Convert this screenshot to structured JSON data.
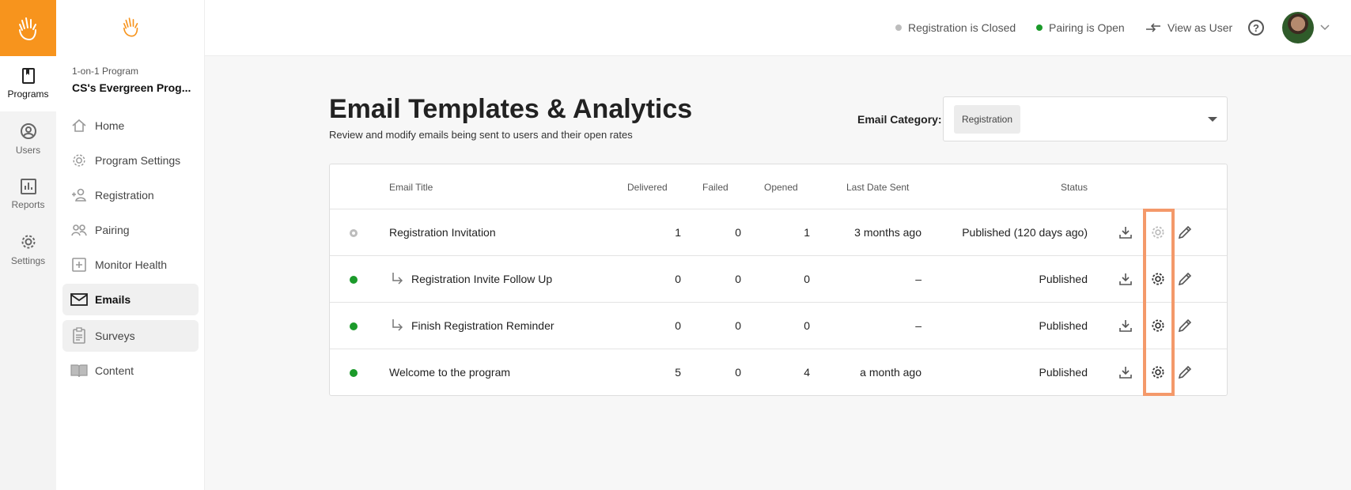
{
  "rail": {
    "items": [
      {
        "label": "Programs",
        "icon": "programs-icon"
      },
      {
        "label": "Users",
        "icon": "user-icon"
      },
      {
        "label": "Reports",
        "icon": "reports-icon"
      },
      {
        "label": "Settings",
        "icon": "gear-icon"
      }
    ]
  },
  "sidenav": {
    "program_type": "1-on-1 Program",
    "program_name": "CS's Evergreen Prog...",
    "items": [
      {
        "label": "Home",
        "icon": "home-icon"
      },
      {
        "label": "Program Settings",
        "icon": "gear-icon"
      },
      {
        "label": "Registration",
        "icon": "add-user-icon"
      },
      {
        "label": "Pairing",
        "icon": "pairing-icon"
      },
      {
        "label": "Monitor Health",
        "icon": "plus-box-icon"
      },
      {
        "label": "Emails",
        "icon": "mail-icon"
      },
      {
        "label": "Surveys",
        "icon": "clipboard-icon"
      },
      {
        "label": "Content",
        "icon": "book-icon"
      }
    ]
  },
  "header": {
    "registration_status": "Registration is Closed",
    "pairing_status": "Pairing is Open",
    "view_as_user": "View as User",
    "help": "?"
  },
  "main": {
    "title": "Email Templates & Analytics",
    "subtitle": "Review and modify emails being sent to users and their open rates",
    "category_label": "Email Category:",
    "category_value": "Registration"
  },
  "table": {
    "headers": {
      "title": "Email Title",
      "delivered": "Delivered",
      "failed": "Failed",
      "opened": "Opened",
      "last_sent": "Last Date Sent",
      "status": "Status"
    },
    "rows": [
      {
        "state": "draft",
        "indent": false,
        "title": "Registration Invitation",
        "delivered": "1",
        "failed": "0",
        "opened": "1",
        "last_sent": "3 months ago",
        "status": "Published (120 days ago)"
      },
      {
        "state": "live",
        "indent": true,
        "title": "Registration Invite Follow Up",
        "delivered": "0",
        "failed": "0",
        "opened": "0",
        "last_sent": "–",
        "status": "Published"
      },
      {
        "state": "live",
        "indent": true,
        "title": "Finish Registration Reminder",
        "delivered": "0",
        "failed": "0",
        "opened": "0",
        "last_sent": "–",
        "status": "Published"
      },
      {
        "state": "live",
        "indent": false,
        "title": "Welcome to the program",
        "delivered": "5",
        "failed": "0",
        "opened": "4",
        "last_sent": "a month ago",
        "status": "Published"
      }
    ]
  },
  "colors": {
    "brand": "#f7941d",
    "status_open": "#1b9a2a",
    "status_closed": "#bdbdbd",
    "highlight": "#f4996a"
  }
}
